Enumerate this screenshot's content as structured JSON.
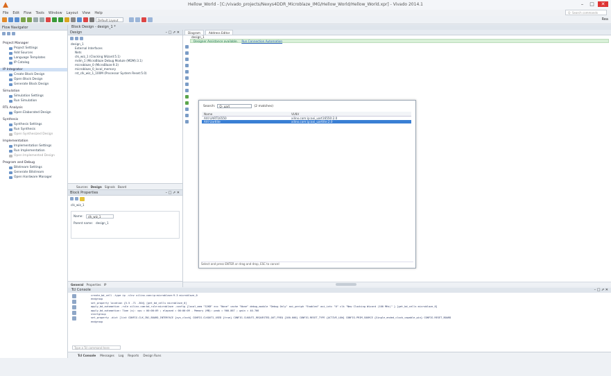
{
  "window": {
    "title": "Hellow_World - [C:/vivado_projects/Nexys4DDR_Microblaze_IMG/Hellow_World/Hellow_World.xpr] - Vivado 2014.1",
    "minimize": "–",
    "maximize": "□",
    "close": "✕"
  },
  "menu": [
    "File",
    "Edit",
    "Flow",
    "Tools",
    "Window",
    "Layout",
    "View",
    "Help"
  ],
  "search_placeholder": "Q- Search commands",
  "toolbar": {
    "layout_combo": "Default Layout",
    "right_label": "Rea"
  },
  "flow_navigator": {
    "title": "Flow Navigator",
    "sections": [
      {
        "label": "Project Manager",
        "items": [
          "Project Settings",
          "Add Sources",
          "Language Templates",
          "IP Catalog"
        ]
      },
      {
        "label": "IP Integrator",
        "items": [
          "Create Block Design",
          "Open Block Design",
          "Generate Block Design"
        ]
      },
      {
        "label": "Simulation",
        "items": [
          "Simulation Settings",
          "Run Simulation"
        ]
      },
      {
        "label": "RTL Analysis",
        "items": [
          "Open Elaborated Design"
        ]
      },
      {
        "label": "Synthesis",
        "items": [
          "Synthesis Settings",
          "Run Synthesis",
          "Open Synthesized Design"
        ]
      },
      {
        "label": "Implementation",
        "items": [
          "Implementation Settings",
          "Run Implementation",
          "Open Implemented Design"
        ]
      },
      {
        "label": "Program and Debug",
        "items": [
          "Bitstream Settings",
          "Generate Bitstream",
          "Open Hardware Manager"
        ]
      }
    ]
  },
  "block_design": {
    "header": "Block Design - design_1 *",
    "design_tab": "Design",
    "tree": [
      "design_1",
      "External Interfaces",
      "Nets",
      "clk_wiz_1 (Clocking Wizard:5.1)",
      "mdm_1 (MicroBlaze Debug Module (MDM):3.1)",
      "microblaze_0 (MicroBlaze:9.3)",
      "microblaze_0_local_memory",
      "rst_clk_wiz_1_100M (Processor System Reset:5.0)"
    ],
    "tabs": [
      "Sources",
      "Design",
      "Signals",
      "Board"
    ]
  },
  "properties": {
    "header": "Block Properties",
    "name_label": "Name:",
    "name_value": "clk_wiz_1",
    "parent_label": "Parent name:",
    "parent_value": "design_1",
    "tabs": [
      "General",
      "Properties",
      "IP"
    ],
    "selected": "clk_wiz_1"
  },
  "diagram": {
    "tabs": [
      "Diagram",
      "Address Editor"
    ],
    "sub_tab": "design_1",
    "notice": "Designer Assistance available.",
    "notice_link": "Run Connection Automation",
    "popup": {
      "search_label": "Search:",
      "search_value": "Q- uart",
      "matches": "(2 matches)",
      "columns": [
        "Name",
        "VLNV"
      ],
      "rows": [
        {
          "name": "AXI UART16550",
          "vlnv": "xilinx.com:ip:axi_uart16550:2.0",
          "selected": false
        },
        {
          "name": "AXI Uartlite",
          "vlnv": "xilinx.com:ip:axi_uartlite:2.0",
          "selected": true
        }
      ],
      "hint": "Select and press ENTER or drag and drop, ESC to cancel"
    }
  },
  "tcl_console": {
    "header": "Tcl Console",
    "lines": [
      "create_bd_cell -type ip -vlnv xilinx.com:ip:microblaze:9.3 microblaze_0",
      "endgroup",
      "set_property location {5.5 -71 -304} [get_bd_cells microblaze_0]",
      "apply_bd_automation -rule xilinx.com:bd_rule:microblaze -config {local_mem \"32KB\" ecc \"None\" cache \"None\" debug_module \"Debug Only\" axi_periph \"Enabled\" axi_intc \"0\" clk \"New Clocking Wizard (100 MHz)\" }  [get_bd_cells microblaze_0]",
      "apply_bd_automation: Time (s): cpu = 00:00:09 ; elapsed = 00:00:09 . Memory (MB): peak = 900.867 ; gain = 40.766",
      "startgroup",
      "set_property -dict [list CONFIG.CLK_IN1_BOARD_INTERFACE {sys_clock} CONFIG.CLKOUT1_USED {true} CONFIG.CLKOUT1_REQUESTED_OUT_FREQ {100.000} CONFIG.RESET_TYPE {ACTIVE_LOW} CONFIG.PRIM_SOURCE {Single_ended_clock_capable_pin} CONFIG.RESET_BOARD",
      "endgroup"
    ],
    "cmd_placeholder": "Type a Tcl command here"
  },
  "bottom_tabs": [
    "Tcl Console",
    "Messages",
    "Log",
    "Reports",
    "Design Runs"
  ],
  "colors": {
    "accent": "#3a7fd4",
    "notice_bg": "#d9f0d8"
  }
}
